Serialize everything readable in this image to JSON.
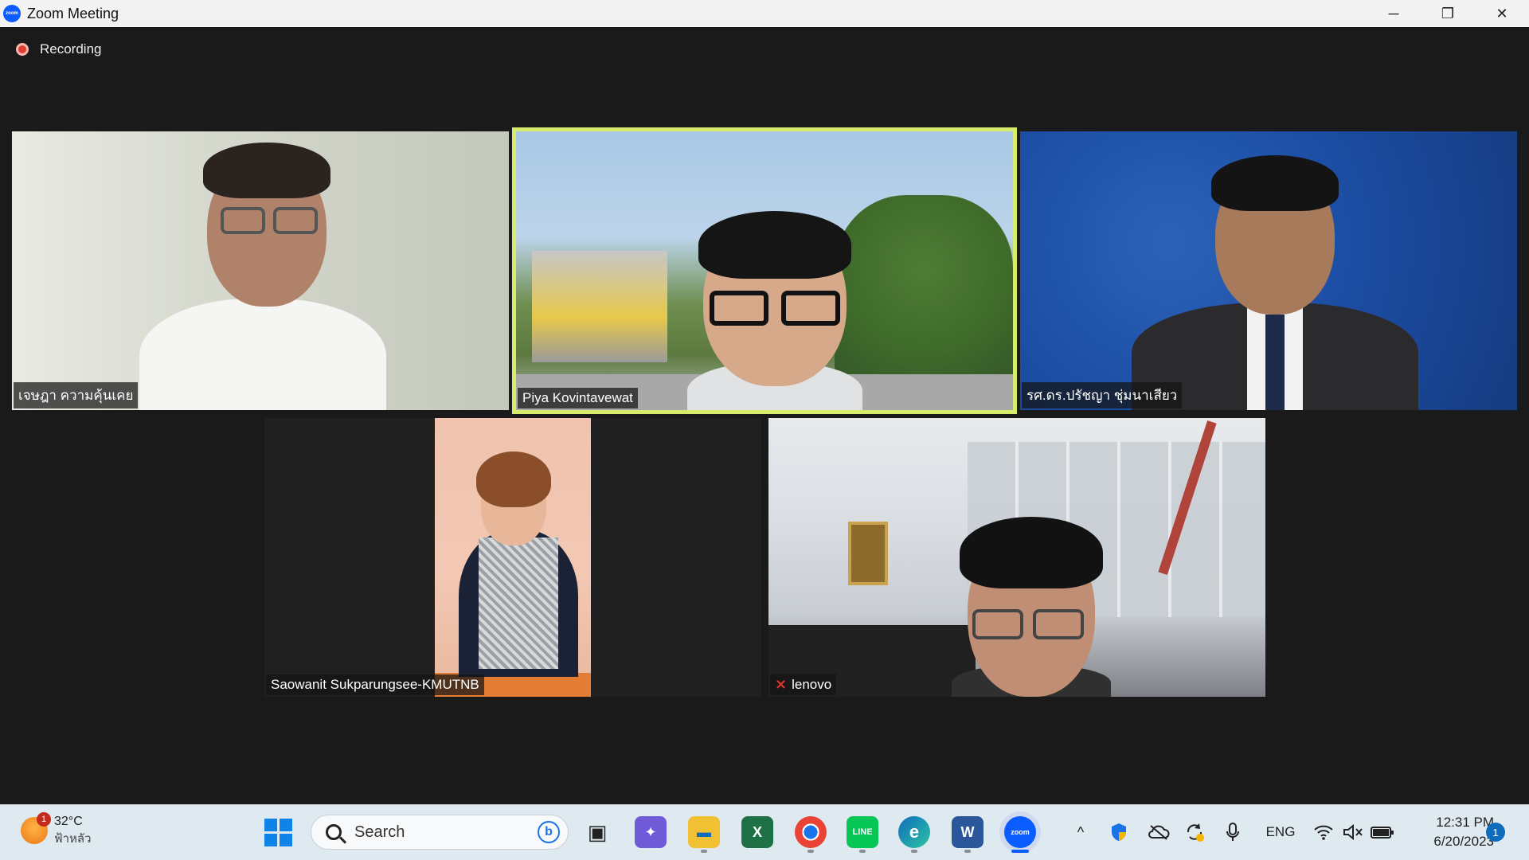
{
  "window": {
    "title": "Zoom Meeting",
    "app_icon_label": "zoom",
    "minimize_glyph": "─",
    "restore_glyph": "❐",
    "close_glyph": "✕"
  },
  "meeting": {
    "recording_label": "Recording",
    "participants": [
      {
        "name": "เจษฎา ความคุ้นเคย",
        "muted": false,
        "active_speaker": false
      },
      {
        "name": "Piya Kovintavewat",
        "muted": false,
        "active_speaker": true
      },
      {
        "name": "รศ.ดร.ปรัชญา ชุ่มนาเสียว",
        "muted": false,
        "active_speaker": false
      },
      {
        "name": "Saowanit Sukparungsee-KMUTNB",
        "muted": false,
        "active_speaker": false
      },
      {
        "name": "lenovo",
        "muted": true,
        "active_speaker": false
      }
    ],
    "muted_glyph": "⨯"
  },
  "taskbar": {
    "weather": {
      "temp": "32°C",
      "condition": "ฟ้าหลัว",
      "badge": "1"
    },
    "search_placeholder": "Search",
    "bing_glyph": "b",
    "apps": [
      {
        "name": "task-view",
        "glyph": "▣"
      },
      {
        "name": "chat",
        "glyph": "✦"
      },
      {
        "name": "file-explorer",
        "glyph": "▬"
      },
      {
        "name": "excel-app",
        "glyph": "X"
      },
      {
        "name": "chrome",
        "glyph": "◉"
      },
      {
        "name": "line",
        "glyph": "LINE"
      },
      {
        "name": "edge",
        "glyph": "e"
      },
      {
        "name": "word",
        "glyph": "W"
      },
      {
        "name": "zoom",
        "glyph": "zoom"
      }
    ],
    "tray": {
      "overflow_glyph": "^",
      "language": "ENG",
      "time": "12:31 PM",
      "date": "6/20/2023",
      "notification_count": "1"
    }
  }
}
